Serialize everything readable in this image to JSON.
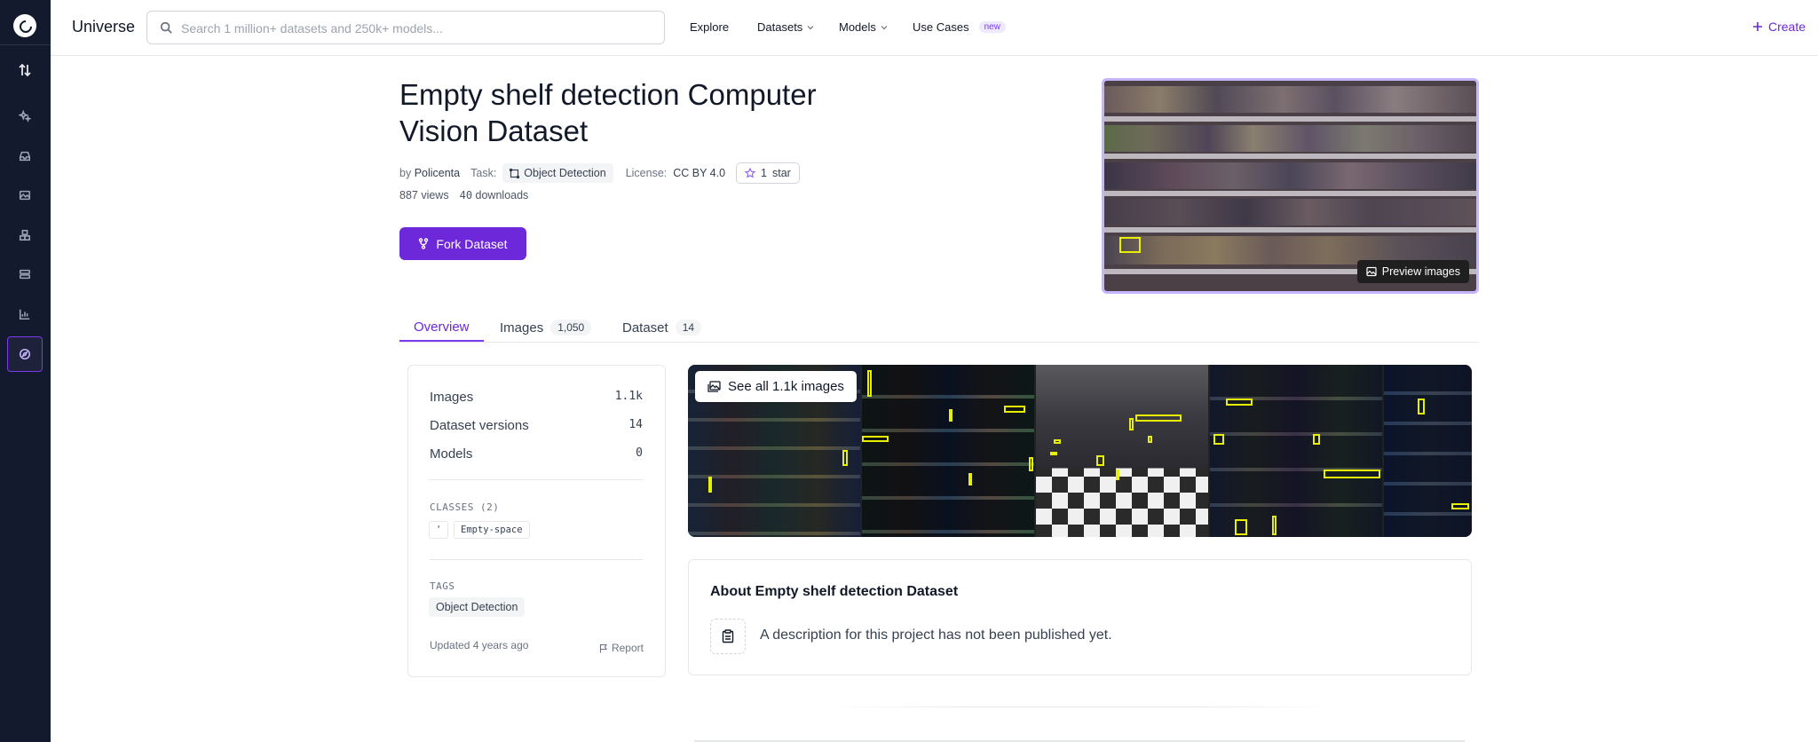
{
  "app": {
    "brand": "Universe",
    "create_label": "Create"
  },
  "search": {
    "placeholder": "Search 1 million+ datasets and 250k+ models..."
  },
  "nav": [
    {
      "label": "Explore"
    },
    {
      "label": "Datasets"
    },
    {
      "label": "Models"
    },
    {
      "label": "Use Cases",
      "badge": "new"
    }
  ],
  "dataset": {
    "title": "Empty shelf detection Computer Vision Dataset",
    "by_label": "by",
    "author": "Policenta",
    "task_label": "Task:",
    "task": "Object Detection",
    "license_label": "License:",
    "license": "CC BY 4.0",
    "star_count": "1",
    "star_label": "star",
    "views": "887 views",
    "downloads_num": "40",
    "downloads_label": "downloads",
    "fork_label": "Fork Dataset",
    "preview_label": "Preview images"
  },
  "tabs": [
    {
      "label": "Overview"
    },
    {
      "label": "Images",
      "count": "1,050"
    },
    {
      "label": "Dataset",
      "count": "14"
    }
  ],
  "info": {
    "rows": [
      {
        "label": "Images",
        "value": "1.1k"
      },
      {
        "label": "Dataset versions",
        "value": "14"
      },
      {
        "label": "Models",
        "value": "0"
      }
    ],
    "classes_label": "CLASSES (2)",
    "classes": [
      "'",
      "Empty-space"
    ],
    "tags_label": "TAGS",
    "tags": [
      "Object Detection"
    ],
    "updated": "Updated 4 years ago",
    "report_label": "Report"
  },
  "gallery": {
    "see_all_label": "See all 1.1k images"
  },
  "about": {
    "title": "About Empty shelf detection Dataset",
    "description": "A description for this project has not been published yet."
  },
  "colors": {
    "accent": "#6d28d9",
    "rail": "#141a2e",
    "bbox": "#e8f000"
  }
}
